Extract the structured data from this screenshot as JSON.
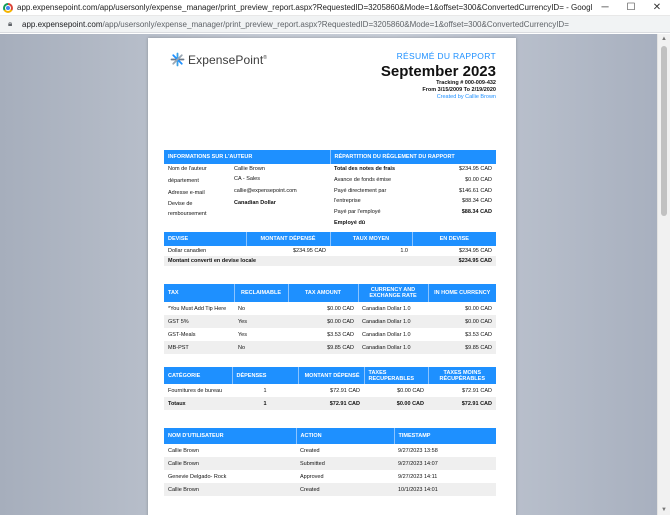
{
  "window": {
    "title": "app.expensepoint.com/app/usersonly/expense_manager/print_preview_report.aspx?RequestedID=3205860&Mode=1&offset=300&ConvertedCurrencyID= - Google Chrome",
    "minimize": "─",
    "maximize": "☐",
    "close": "✕"
  },
  "urlbar": {
    "domain": "app.expensepoint.com",
    "path": "/app/usersonly/expense_manager/print_preview_report.aspx?RequestedID=3205860&Mode=1&offset=300&ConvertedCurrencyID="
  },
  "report": {
    "logo": "ExpensePoint",
    "logo_tm": "®",
    "title": "RÉSUMÉ DU RAPPORT",
    "month": "September 2023",
    "tracking": "Tracking # 000-009-432",
    "range": "From 3/15/2009 To 2/19/2020",
    "created_by": "Created by Callie Brown"
  },
  "info": {
    "left_header": "INFORMATIONS SUR L'AUTEUR",
    "right_header": "RÉPARTITION DU RÈGLEMENT DU RAPPORT",
    "author_label": "Nom de l'auteur",
    "author_value": "Callie Brown",
    "dept_label": "département",
    "dept_value": "CA - Sales",
    "email_label": "Adresse e-mail",
    "email_value": "callie@expensepoint.com",
    "currency_label_1": "Devise de",
    "currency_label_2": "remboursement",
    "currency_value": "Canadian Dollar",
    "total_label": "Total des notes de frais",
    "total_value": "$234.95 CAD",
    "advance_label": "Avance de fonds émise",
    "advance_value": "$0.00 CAD",
    "company_label_1": "Payé directement par",
    "company_label_2": "l'entreprise",
    "company_value_1": "$146.61 CAD",
    "company_value_2": "$88.34 CAD",
    "employee_label": "Payé par l'employé",
    "employee_value": "$88.34 CAD",
    "employee_due_label": "Employé dû"
  },
  "devise": {
    "headers": [
      "DEVISE",
      "MONTANT DÉPENSÉ",
      "TAUX MOYEN",
      "EN DEVISE"
    ],
    "row": [
      "Dollar canadien",
      "$234.95 CAD",
      "1.0",
      "$234.95 CAD"
    ],
    "total_label": "Montant converti en devise locale",
    "total_value": "$234.95 CAD"
  },
  "tax": {
    "headers": [
      "TAX",
      "RECLAIMABLE",
      "TAX AMOUNT",
      "CURRENCY AND EXCHANGE RATE",
      "IN HOME CURRENCY"
    ],
    "rows": [
      [
        "*You Must Add Tip Here",
        "No",
        "$0.00 CAD",
        "Canadian Dollar 1.0",
        "$0.00 CAD"
      ],
      [
        "GST 5%",
        "Yes",
        "$0.00 CAD",
        "Canadian Dollar 1.0",
        "$0.00 CAD"
      ],
      [
        "GST-Meals",
        "Yes",
        "$3.53 CAD",
        "Canadian Dollar 1.0",
        "$3.53 CAD"
      ],
      [
        "MB-PST",
        "No",
        "$9.85 CAD",
        "Canadian Dollar 1.0",
        "$9.85 CAD"
      ]
    ]
  },
  "category": {
    "headers": [
      "CATÉGORIE",
      "DÉPENSES",
      "MONTANT DÉPENSÉ",
      "TAXES RECUPERABLES",
      "TAXES MOINS RÉCUPÉRABLES"
    ],
    "rows": [
      [
        "Fournitures de bureau",
        "1",
        "$72.91 CAD",
        "$0.00 CAD",
        "$72.91 CAD"
      ]
    ],
    "total": [
      "Totaux",
      "1",
      "$72.91 CAD",
      "$0.00 CAD",
      "$72.91 CAD"
    ]
  },
  "audit": {
    "headers": [
      "NOM D'UTILISATEUR",
      "ACTION",
      "TIMESTAMP"
    ],
    "rows": [
      [
        "Callie Brown",
        "Created",
        "9/27/2023 13:58"
      ],
      [
        "Callie Brown",
        "Submitted",
        "9/27/2023 14:07"
      ],
      [
        "Genevie Delgado- Rock",
        "Approved",
        "9/27/2023 14:11"
      ],
      [
        "Callie Brown",
        "Created",
        "10/1/2023 14:01"
      ]
    ]
  }
}
